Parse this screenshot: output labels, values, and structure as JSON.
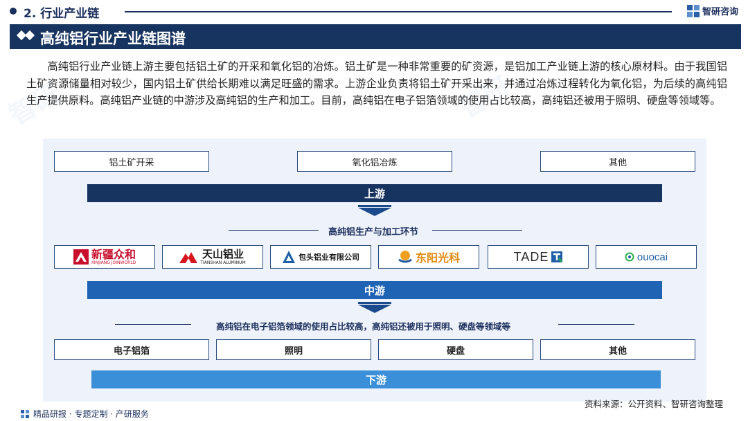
{
  "section": {
    "title": "2. 行业产业链"
  },
  "brand": {
    "name": "智研咨询",
    "logo_icon": "zhiyan-logo-icon"
  },
  "banner": {
    "title": "高纯铝行业产业链图谱",
    "icon": "double-diamond-icon"
  },
  "intro": "高纯铝行业产业链上游主要包括铝土矿的开采和氧化铝的冶炼。铝土矿是一种非常重要的矿资源，是铝加工产业链上游的核心原材料。由于我国铝土矿资源储量相对较少，国内铝土矿供给长期难以满足旺盛的需求。上游企业负责将铝土矿开采出来，并通过冶炼过程转化为氧化铝，为后续的高纯铝生产提供原料。高纯铝产业链的中游涉及高纯铝的生产和加工。目前，高纯铝在电子铝箔领域的使用占比较高，高纯铝还被用于照明、硬盘等领域等。",
  "upstream": {
    "items": [
      "铝土矿开采",
      "氧化铝冶炼",
      "其他"
    ],
    "label": "上游"
  },
  "midstream": {
    "caption": "高纯铝生产与加工环节",
    "companies": [
      {
        "name": "新疆众和",
        "sub": "XINJIANG JOINWORLD",
        "icon": "joinworld-logo-icon"
      },
      {
        "name": "天山铝业",
        "sub": "TIANSHAN ALUMINUM",
        "icon": "tianshan-logo-icon"
      },
      {
        "name": "包头铝业有限公司",
        "sub": "",
        "icon": "baotou-logo-icon"
      },
      {
        "name": "东阳光科",
        "sub": "",
        "icon": "dongyangguang-logo-icon"
      },
      {
        "name": "TADE",
        "sub": "",
        "icon": "tade-logo-icon"
      },
      {
        "name": "ouocai",
        "sub": "",
        "icon": "guocai-logo-icon"
      }
    ],
    "label": "中游"
  },
  "downstream": {
    "caption": "高纯铝在电子铝箔领域的使用占比较高，高纯铝还被用于照明、硬盘等领域等",
    "items": [
      "电子铝箔",
      "照明",
      "硬盘",
      "其他"
    ],
    "label": "下游"
  },
  "footer": {
    "left": "精品研报 · 专题定制 · 产研服务",
    "source": "资料来源：公开资料、智研咨询整理"
  },
  "colors": {
    "navy": "#17335f",
    "mid_blue": "#1f63b5",
    "light_blue": "#3a8fd8",
    "panel_bg": "#eef2fa"
  }
}
